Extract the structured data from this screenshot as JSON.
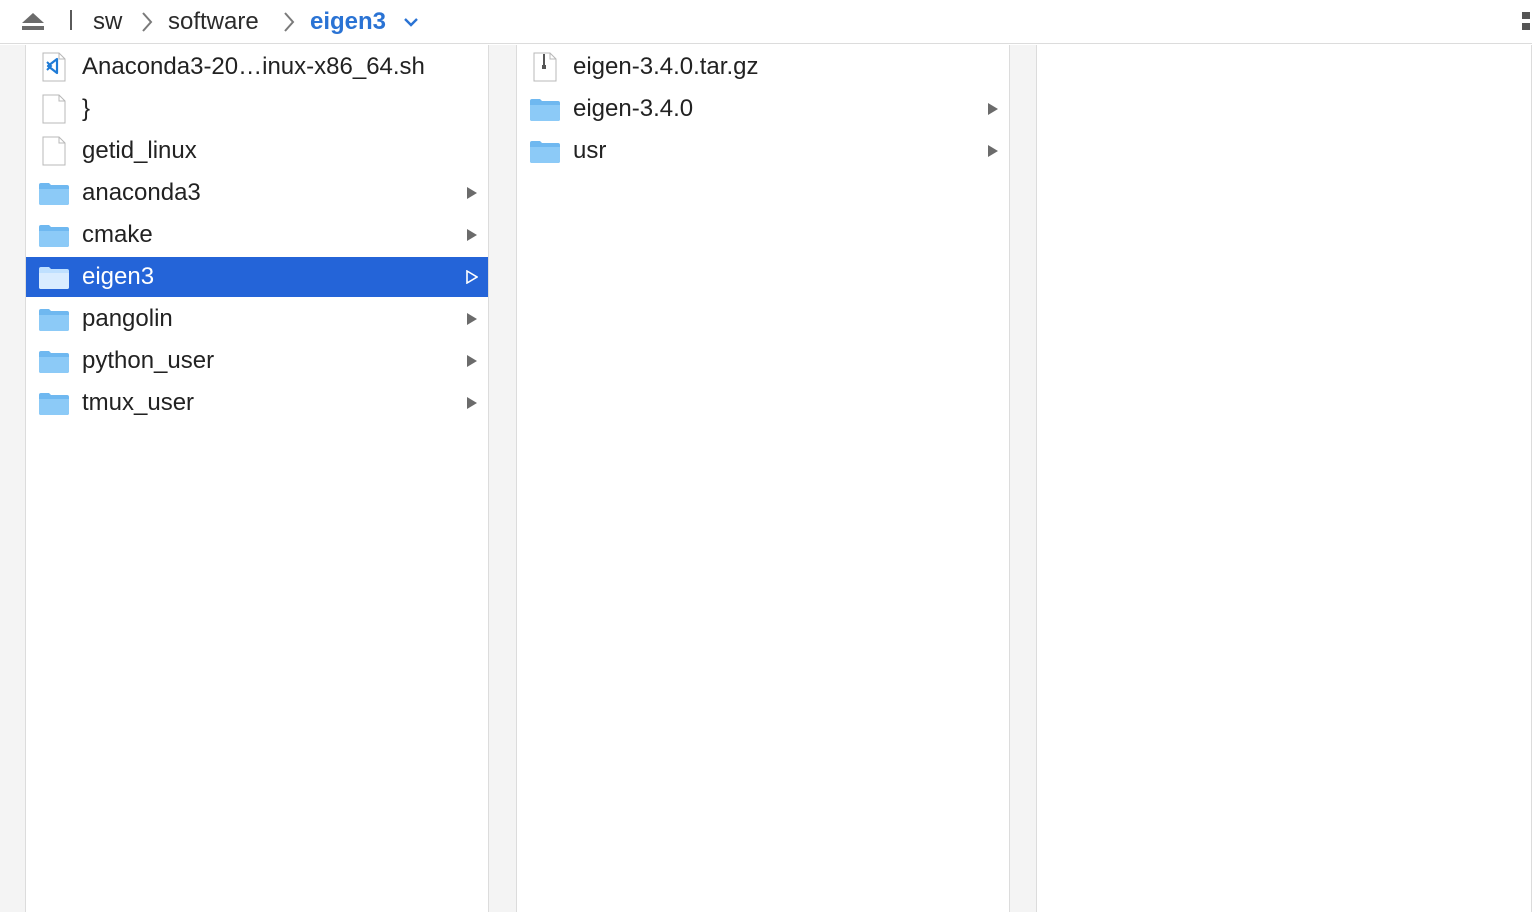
{
  "breadcrumb": {
    "items": [
      "sw",
      "software"
    ],
    "current": "eigen3"
  },
  "columns": [
    {
      "items": [
        {
          "label": "Anaconda3-20…inux-x86_64.sh",
          "icon": "vscode-script-file-icon",
          "type": "file"
        },
        {
          "label": "}",
          "icon": "document-icon",
          "type": "file"
        },
        {
          "label": "getid_linux",
          "icon": "document-icon",
          "type": "file"
        },
        {
          "label": "anaconda3",
          "icon": "folder-icon",
          "type": "folder"
        },
        {
          "label": "cmake",
          "icon": "folder-icon",
          "type": "folder"
        },
        {
          "label": "eigen3",
          "icon": "folder-icon",
          "type": "folder",
          "selected": true
        },
        {
          "label": "pangolin",
          "icon": "folder-icon",
          "type": "folder"
        },
        {
          "label": "python_user",
          "icon": "folder-icon",
          "type": "folder"
        },
        {
          "label": "tmux_user",
          "icon": "folder-icon",
          "type": "folder"
        }
      ]
    },
    {
      "items": [
        {
          "label": "eigen-3.4.0.tar.gz",
          "icon": "archive-icon",
          "type": "file"
        },
        {
          "label": "eigen-3.4.0",
          "icon": "folder-icon",
          "type": "folder"
        },
        {
          "label": "usr",
          "icon": "folder-icon",
          "type": "folder"
        }
      ]
    },
    {
      "items": []
    }
  ],
  "colors": {
    "selection": "#2464d8",
    "folder": "#5aaef0",
    "accent": "#2a73d4"
  }
}
